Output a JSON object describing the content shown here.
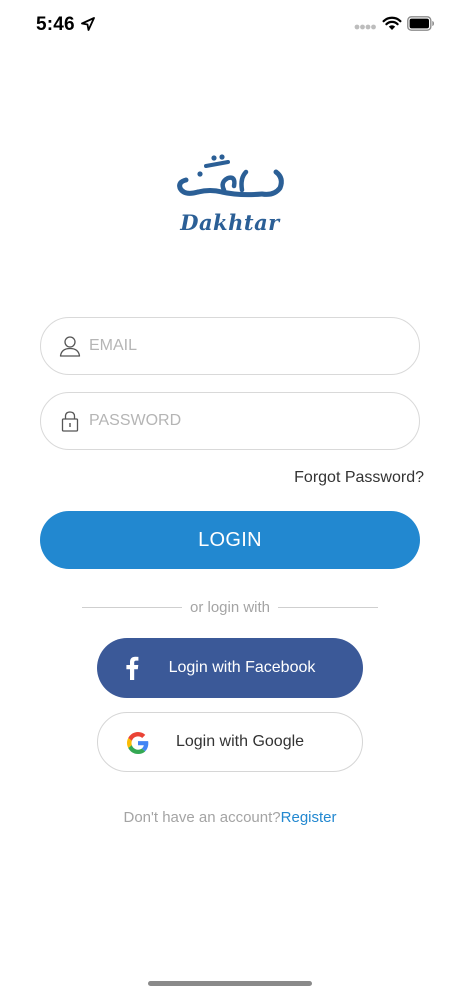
{
  "status_bar": {
    "time": "5:46",
    "icons": [
      "location-arrow-icon",
      "cellular-signal-icon",
      "wifi-icon",
      "battery-icon"
    ]
  },
  "logo": {
    "wordmark": "Dakhtar",
    "color": "#2b5f96"
  },
  "email": {
    "placeholder": "EMAIL",
    "value": "",
    "icon": "user-icon"
  },
  "password": {
    "placeholder": "PASSWORD",
    "value": "",
    "icon": "lock-icon"
  },
  "forgot_password": "Forgot Password?",
  "login_button": "LOGIN",
  "divider_text": "or login with",
  "facebook": {
    "label": "Login with Facebook",
    "icon": "facebook-icon",
    "color": "#3b5998"
  },
  "google": {
    "label": "Login with Google",
    "icon": "google-icon"
  },
  "register": {
    "prompt": "Don't have an account?",
    "link": "Register"
  },
  "colors": {
    "accent": "#2288d0",
    "muted_text": "#a4a4a4",
    "border": "#d9d9d9"
  }
}
